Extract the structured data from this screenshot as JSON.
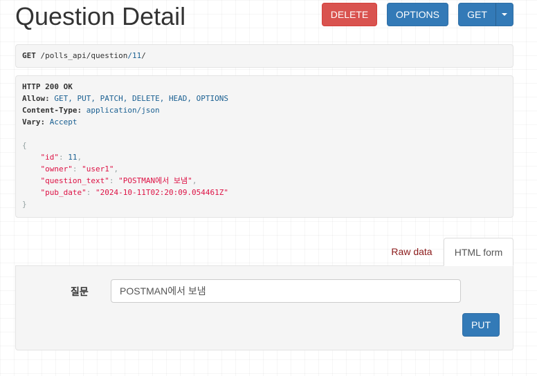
{
  "header": {
    "title": "Question Detail",
    "delete_label": "DELETE",
    "options_label": "OPTIONS",
    "get_label": "GET"
  },
  "request": {
    "method": "GET",
    "path_parts": [
      "/polls_api",
      "/question",
      "/11",
      "/"
    ]
  },
  "response": {
    "status_line": "HTTP 200 OK",
    "headers": [
      {
        "name": "Allow:",
        "value": "GET, PUT, PATCH, DELETE, HEAD, OPTIONS"
      },
      {
        "name": "Content-Type:",
        "value": "application/json"
      },
      {
        "name": "Vary:",
        "value": "Accept"
      }
    ],
    "body": {
      "open": "{",
      "close": "}",
      "fields": [
        {
          "key": "\"id\"",
          "value": "11",
          "type": "number",
          "trail": ","
        },
        {
          "key": "\"owner\"",
          "value": "\"user1\"",
          "type": "string",
          "trail": ","
        },
        {
          "key": "\"question_text\"",
          "value": "\"POSTMAN에서 보냄\"",
          "type": "string",
          "trail": ","
        },
        {
          "key": "\"pub_date\"",
          "value": "\"2024-10-11T02:20:09.054461Z\"",
          "type": "string",
          "trail": ""
        }
      ]
    }
  },
  "tabs": {
    "raw_label": "Raw data",
    "html_label": "HTML form"
  },
  "form": {
    "field_label": "질문",
    "field_value": "POSTMAN에서 보냄",
    "submit_label": "PUT"
  },
  "colors": {
    "danger": "#d9534f",
    "primary": "#337ab7",
    "tab_link": "#8b1a1a"
  }
}
